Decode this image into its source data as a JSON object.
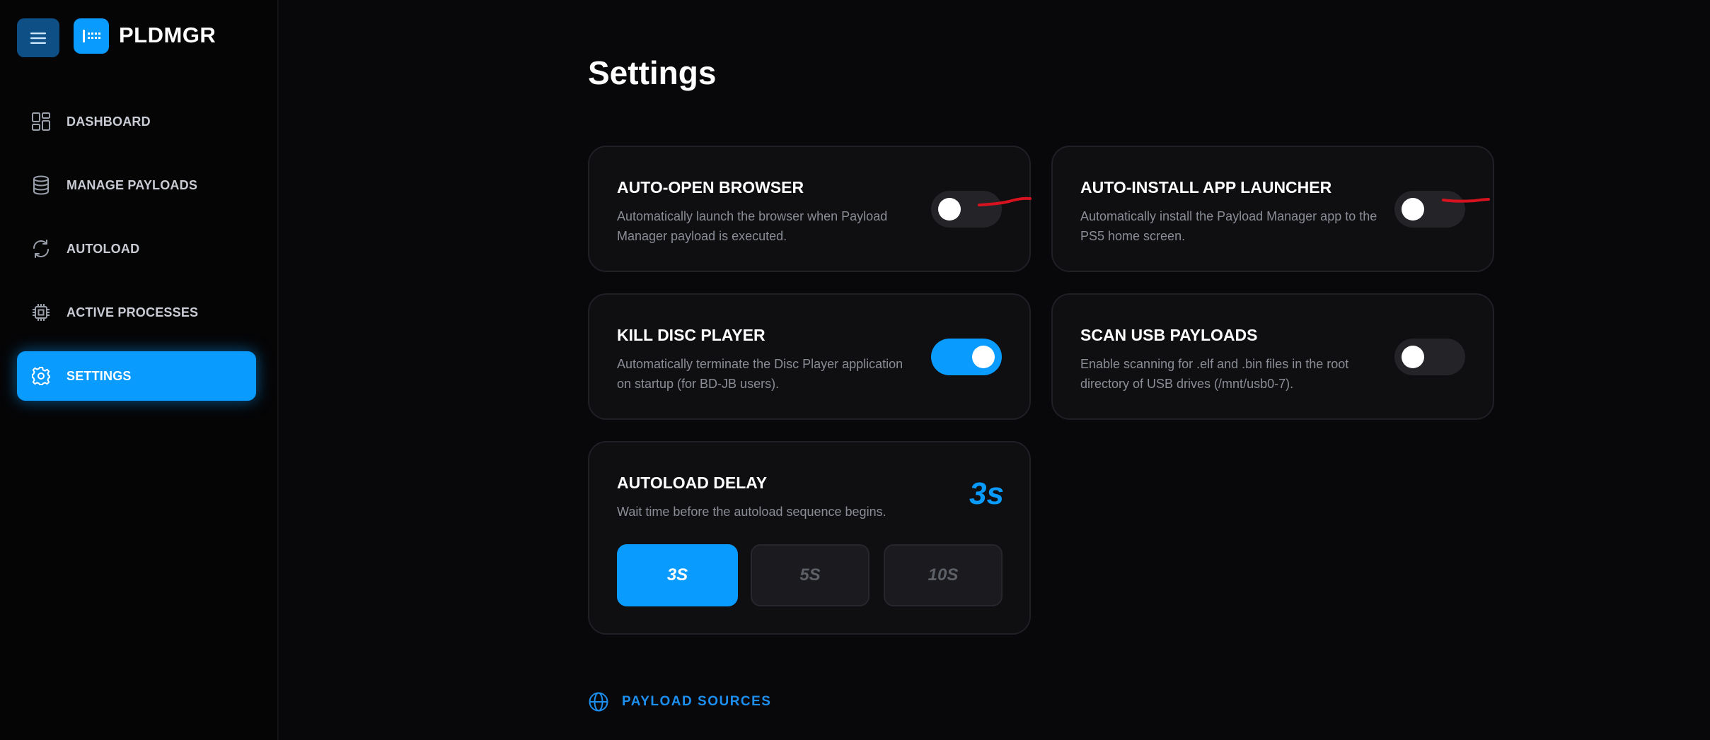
{
  "brand": {
    "name": "PLDMGR"
  },
  "icons": {
    "menu": "menu-icon",
    "logo": "pldmgr-logo-icon",
    "dashboard": "dashboard-grid-icon",
    "payloads": "database-icon",
    "autoload": "refresh-icon",
    "processes": "cpu-chip-icon",
    "settings": "gear-icon",
    "sources": "globe-icon"
  },
  "colors": {
    "accent": "#0a9bff",
    "background": "#08080a",
    "card": "#0f0f12",
    "annotation": "#d6131f"
  },
  "sidebar": {
    "items": [
      {
        "label": "DASHBOARD",
        "active": false
      },
      {
        "label": "MANAGE PAYLOADS",
        "active": false
      },
      {
        "label": "AUTOLOAD",
        "active": false
      },
      {
        "label": "ACTIVE PROCESSES",
        "active": false
      },
      {
        "label": "SETTINGS",
        "active": true
      }
    ]
  },
  "main": {
    "title": "Settings",
    "settings": [
      {
        "title": "AUTO-OPEN BROWSER",
        "description": "Automatically launch the browser when Payload Manager payload is executed.",
        "enabled": false
      },
      {
        "title": "AUTO-INSTALL APP LAUNCHER",
        "description": "Automatically install the Payload Manager app to the PS5 home screen.",
        "enabled": false
      },
      {
        "title": "KILL DISC PLAYER",
        "description": "Automatically terminate the Disc Player application on startup (for BD-JB users).",
        "enabled": true
      },
      {
        "title": "SCAN USB PAYLOADS",
        "description": "Enable scanning for .elf and .bin files in the root directory of USB drives (/mnt/usb0-7).",
        "enabled": false
      }
    ],
    "autoload_delay": {
      "title": "AUTOLOAD DELAY",
      "description": "Wait time before the autoload sequence begins.",
      "value": "3s",
      "options": [
        {
          "label": "3S",
          "active": true
        },
        {
          "label": "5S",
          "active": false
        },
        {
          "label": "10S",
          "active": false
        }
      ]
    },
    "payload_sources": {
      "label": "PAYLOAD SOURCES"
    }
  }
}
